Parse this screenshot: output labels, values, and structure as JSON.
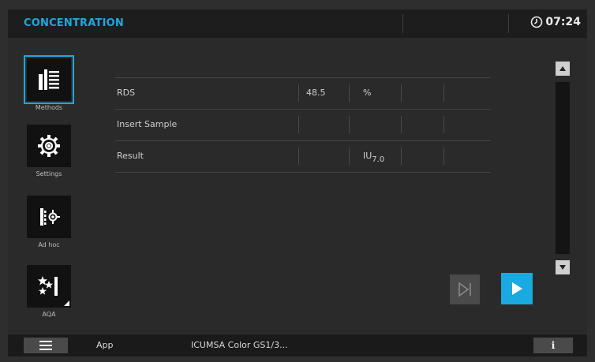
{
  "header": {
    "title": "CONCENTRATION",
    "time": "07:24",
    "clock_icon": "clock-icon"
  },
  "sidebar": {
    "items": [
      {
        "label": "Methods",
        "icon": "methods-icon",
        "active": true
      },
      {
        "label": "Settings",
        "icon": "gear-icon",
        "active": false
      },
      {
        "label": "Ad hoc",
        "icon": "ad-hoc-icon",
        "active": false
      },
      {
        "label": "AQA",
        "icon": "aqa-icon",
        "active": false
      }
    ]
  },
  "table": {
    "rows": [
      {
        "name": "RDS",
        "value": "48.5",
        "unit": "%"
      },
      {
        "name": "Insert Sample",
        "value": "",
        "unit": ""
      },
      {
        "name": "Result",
        "value": "",
        "unit_main": "IU",
        "unit_sub": "7.0"
      }
    ]
  },
  "controls": {
    "skip_icon": "skip-next-icon",
    "play_icon": "play-icon",
    "scroll_up_icon": "triangle-up-icon",
    "scroll_down_icon": "triangle-down-icon"
  },
  "footer": {
    "menu_icon": "hamburger-icon",
    "app_label": "App",
    "method_name": "ICUMSA Color GS1/3...",
    "info_label": "i"
  },
  "colors": {
    "accent": "#1aa9e0",
    "background": "#2e2e2e",
    "bar": "#1d1d1d"
  }
}
